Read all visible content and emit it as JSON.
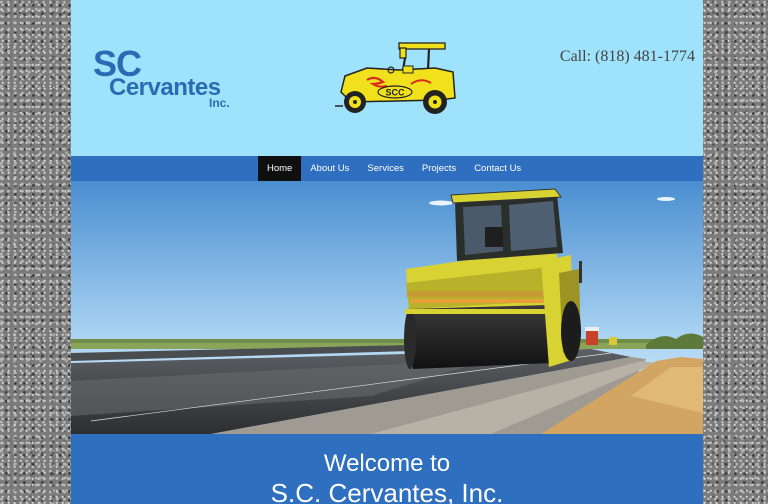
{
  "header": {
    "logo": {
      "line1": "SC",
      "line2": "Cervantes",
      "line3": "Inc."
    },
    "roller_emblem_text": "SCC",
    "phone": "Call: (818) 481-1774"
  },
  "nav": {
    "items": [
      {
        "label": "Home",
        "active": true
      },
      {
        "label": "About Us",
        "active": false
      },
      {
        "label": "Services",
        "active": false
      },
      {
        "label": "Projects",
        "active": false
      },
      {
        "label": "Contact Us",
        "active": false
      }
    ]
  },
  "welcome": {
    "line1": "Welcome to",
    "line2": "S.C. Cervantes, Inc."
  },
  "colors": {
    "header_bg": "#9fe2fb",
    "nav_bg": "#2f6fbf",
    "active_nav": "#0f0f0f",
    "logo_blue": "#2a6cb3",
    "roller_yellow": "#f0e11c"
  }
}
